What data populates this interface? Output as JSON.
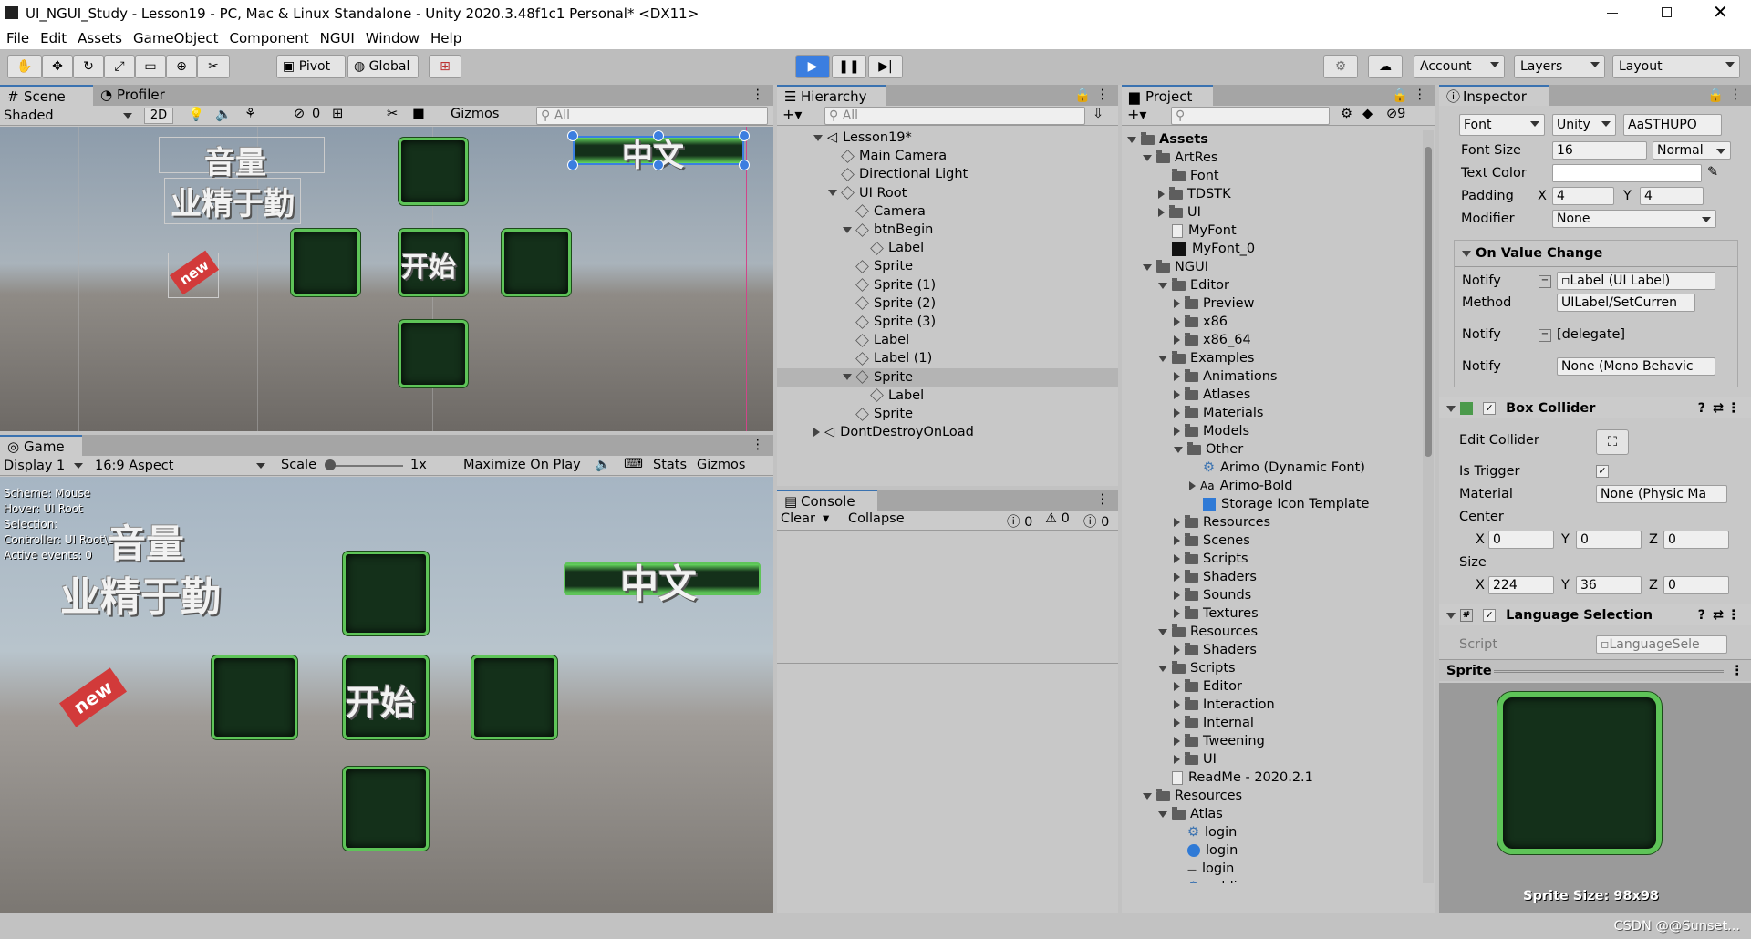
{
  "window": {
    "title": "UI_NGUI_Study - Lesson19 - PC, Mac & Linux Standalone - Unity 2020.3.48f1c1 Personal* <DX11>"
  },
  "menu": [
    "File",
    "Edit",
    "Assets",
    "GameObject",
    "Component",
    "NGUI",
    "Window",
    "Help"
  ],
  "toolbar": {
    "pivot": "Pivot",
    "global": "Global",
    "account": "Account",
    "layers": "Layers",
    "layout": "Layout"
  },
  "scene": {
    "tab": "Scene",
    "tab2": "Profiler",
    "shading": "Shaded",
    "mode2d": "2D",
    "hidden": "0",
    "gizmos": "Gizmos",
    "search": "All"
  },
  "game": {
    "tab": "Game",
    "display": "Display 1",
    "aspect": "16:9 Aspect",
    "scale_label": "Scale",
    "scale_val": "1x",
    "maximize": "Maximize On Play",
    "stats": "Stats",
    "gizmos": "Gizmos",
    "debug": [
      "Scheme: Mouse",
      "Hover: UI Root",
      "Selection:",
      "Controller: UI Root\\Sprite",
      "Active events: 0"
    ]
  },
  "ui_text": {
    "volume": "音量",
    "diligence": "业精于勤",
    "begin": "开始",
    "chinese": "中文",
    "new": "new"
  },
  "hierarchy": {
    "tab": "Hierarchy",
    "search": "All",
    "items": [
      {
        "label": "Lesson19*",
        "depth": 0,
        "exp": "d",
        "ic": "scene"
      },
      {
        "label": "Main Camera",
        "depth": 1,
        "exp": "",
        "ic": "cube"
      },
      {
        "label": "Directional Light",
        "depth": 1,
        "exp": "",
        "ic": "cube"
      },
      {
        "label": "UI Root",
        "depth": 1,
        "exp": "d",
        "ic": "cube"
      },
      {
        "label": "Camera",
        "depth": 2,
        "exp": "",
        "ic": "cube"
      },
      {
        "label": "btnBegin",
        "depth": 2,
        "exp": "d",
        "ic": "cube"
      },
      {
        "label": "Label",
        "depth": 3,
        "exp": "",
        "ic": "cube"
      },
      {
        "label": "Sprite",
        "depth": 2,
        "exp": "",
        "ic": "cube"
      },
      {
        "label": "Sprite (1)",
        "depth": 2,
        "exp": "",
        "ic": "cube"
      },
      {
        "label": "Sprite (2)",
        "depth": 2,
        "exp": "",
        "ic": "cube"
      },
      {
        "label": "Sprite (3)",
        "depth": 2,
        "exp": "",
        "ic": "cube"
      },
      {
        "label": "Label",
        "depth": 2,
        "exp": "",
        "ic": "cube"
      },
      {
        "label": "Label (1)",
        "depth": 2,
        "exp": "",
        "ic": "cube"
      },
      {
        "label": "Sprite",
        "depth": 2,
        "exp": "d",
        "ic": "cube",
        "sel": true
      },
      {
        "label": "Label",
        "depth": 3,
        "exp": "",
        "ic": "cube"
      },
      {
        "label": "Sprite",
        "depth": 2,
        "exp": "",
        "ic": "cube"
      },
      {
        "label": "DontDestroyOnLoad",
        "depth": 0,
        "exp": "r",
        "ic": "scene"
      }
    ]
  },
  "console": {
    "tab": "Console",
    "clear": "Clear",
    "collapse": "Collapse",
    "errors": "0",
    "warnings": "0",
    "logs": "0"
  },
  "project": {
    "tab": "Project",
    "filter_count": "9",
    "items": [
      {
        "label": "Assets",
        "depth": 0,
        "exp": "d",
        "ic": "folder",
        "bold": true
      },
      {
        "label": "ArtRes",
        "depth": 1,
        "exp": "d",
        "ic": "folder"
      },
      {
        "label": "Font",
        "depth": 2,
        "exp": "",
        "ic": "folder"
      },
      {
        "label": "TDSTK",
        "depth": 2,
        "exp": "r",
        "ic": "folder"
      },
      {
        "label": "UI",
        "depth": 2,
        "exp": "r",
        "ic": "folder"
      },
      {
        "label": "MyFont",
        "depth": 2,
        "exp": "",
        "ic": "file"
      },
      {
        "label": "MyFont_0",
        "depth": 2,
        "exp": "",
        "ic": "black"
      },
      {
        "label": "NGUI",
        "depth": 1,
        "exp": "d",
        "ic": "folder"
      },
      {
        "label": "Editor",
        "depth": 2,
        "exp": "d",
        "ic": "folder"
      },
      {
        "label": "Preview",
        "depth": 3,
        "exp": "r",
        "ic": "folder"
      },
      {
        "label": "x86",
        "depth": 3,
        "exp": "r",
        "ic": "folder"
      },
      {
        "label": "x86_64",
        "depth": 3,
        "exp": "r",
        "ic": "folder"
      },
      {
        "label": "Examples",
        "depth": 2,
        "exp": "d",
        "ic": "folder"
      },
      {
        "label": "Animations",
        "depth": 3,
        "exp": "r",
        "ic": "folder"
      },
      {
        "label": "Atlases",
        "depth": 3,
        "exp": "r",
        "ic": "folder"
      },
      {
        "label": "Materials",
        "depth": 3,
        "exp": "r",
        "ic": "folder"
      },
      {
        "label": "Models",
        "depth": 3,
        "exp": "r",
        "ic": "folder"
      },
      {
        "label": "Other",
        "depth": 3,
        "exp": "d",
        "ic": "folder"
      },
      {
        "label": "Arimo (Dynamic Font)",
        "depth": 4,
        "exp": "",
        "ic": "font"
      },
      {
        "label": "Arimo-Bold",
        "depth": 4,
        "exp": "r",
        "ic": "aa"
      },
      {
        "label": "Storage Icon Template",
        "depth": 4,
        "exp": "",
        "ic": "bluecube"
      },
      {
        "label": "Resources",
        "depth": 3,
        "exp": "r",
        "ic": "folder"
      },
      {
        "label": "Scenes",
        "depth": 3,
        "exp": "r",
        "ic": "folder"
      },
      {
        "label": "Scripts",
        "depth": 3,
        "exp": "r",
        "ic": "folder"
      },
      {
        "label": "Shaders",
        "depth": 3,
        "exp": "r",
        "ic": "folder"
      },
      {
        "label": "Sounds",
        "depth": 3,
        "exp": "r",
        "ic": "folder"
      },
      {
        "label": "Textures",
        "depth": 3,
        "exp": "r",
        "ic": "folder"
      },
      {
        "label": "Resources",
        "depth": 2,
        "exp": "d",
        "ic": "folder"
      },
      {
        "label": "Shaders",
        "depth": 3,
        "exp": "r",
        "ic": "folder"
      },
      {
        "label": "Scripts",
        "depth": 2,
        "exp": "d",
        "ic": "folder"
      },
      {
        "label": "Editor",
        "depth": 3,
        "exp": "r",
        "ic": "folder"
      },
      {
        "label": "Interaction",
        "depth": 3,
        "exp": "r",
        "ic": "folder"
      },
      {
        "label": "Internal",
        "depth": 3,
        "exp": "r",
        "ic": "folder"
      },
      {
        "label": "Tweening",
        "depth": 3,
        "exp": "r",
        "ic": "folder"
      },
      {
        "label": "UI",
        "depth": 3,
        "exp": "r",
        "ic": "folder"
      },
      {
        "label": "ReadMe - 2020.2.1",
        "depth": 2,
        "exp": "",
        "ic": "file"
      },
      {
        "label": "Resources",
        "depth": 1,
        "exp": "d",
        "ic": "folder"
      },
      {
        "label": "Atlas",
        "depth": 2,
        "exp": "d",
        "ic": "folder"
      },
      {
        "label": "login",
        "depth": 3,
        "exp": "",
        "ic": "font"
      },
      {
        "label": "login",
        "depth": 3,
        "exp": "",
        "ic": "bluecircle"
      },
      {
        "label": "login",
        "depth": 3,
        "exp": "",
        "ic": "dash"
      },
      {
        "label": "public",
        "depth": 3,
        "exp": "",
        "ic": "font"
      }
    ]
  },
  "inspector": {
    "tab": "Inspector",
    "font_type": "Font",
    "font_src": "Unity",
    "font_name": "STHUPO",
    "font_size_label": "Font Size",
    "font_size": "16",
    "font_style": "Normal",
    "text_color_label": "Text Color",
    "padding_label": "Padding",
    "pad_x": "4",
    "pad_y": "4",
    "modifier_label": "Modifier",
    "modifier": "None",
    "on_value_change": "On Value Change",
    "notify_label": "Notify",
    "notify1": "Label (UI Label)",
    "method_label": "Method",
    "method": "UILabel/SetCurren",
    "notify2": "[delegate]",
    "notify3": "None (Mono Behavic",
    "box_collider": "Box Collider",
    "edit_collider": "Edit Collider",
    "is_trigger": "Is Trigger",
    "material_label": "Material",
    "material": "None (Physic Ma",
    "center_label": "Center",
    "cx": "0",
    "cy": "0",
    "cz": "0",
    "size_label": "Size",
    "sx": "224",
    "sy": "36",
    "sz": "0",
    "lang_sel": "Language Selection",
    "script_label": "Script",
    "script": "LanguageSele",
    "sprite_hdr": "Sprite",
    "sprite_size": "Sprite Size: 98x98",
    "x": "X",
    "y": "Y",
    "z": "Z"
  },
  "watermark": "CSDN @@Sunset..."
}
